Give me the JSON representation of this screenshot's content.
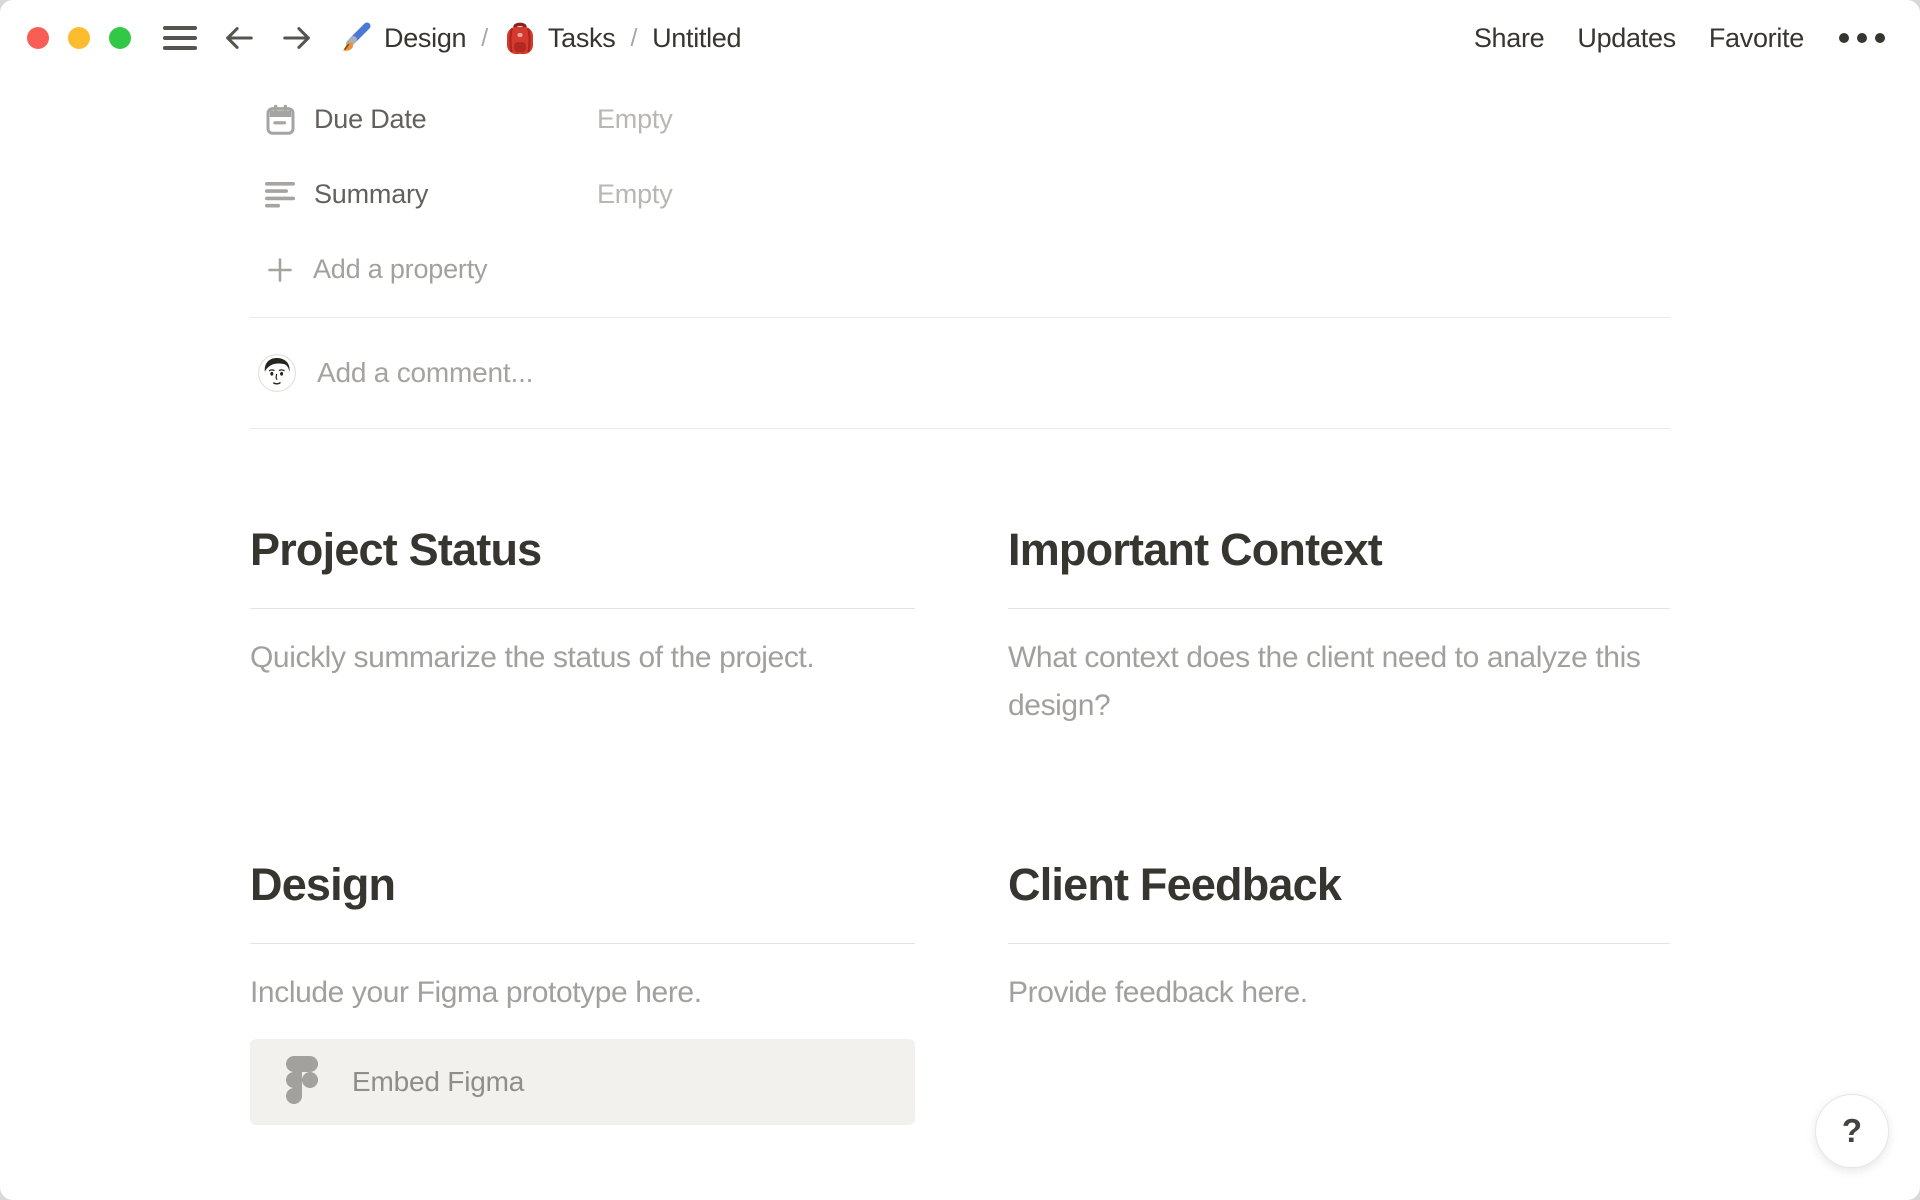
{
  "window": {
    "traffic_lights": [
      "close",
      "minimize",
      "zoom"
    ]
  },
  "topbar": {
    "separator": "/",
    "breadcrumb": {
      "item1": {
        "icon": "paintbrush",
        "label": "Design"
      },
      "item2": {
        "icon": "backpack",
        "label": "Tasks"
      },
      "item3": {
        "label": "Untitled"
      }
    },
    "actions": {
      "share": "Share",
      "updates": "Updates",
      "favorite": "Favorite"
    }
  },
  "properties": {
    "rows": [
      {
        "icon": "calendar-icon",
        "name": "Due Date",
        "value": "Empty"
      },
      {
        "icon": "text-align-icon",
        "name": "Summary",
        "value": "Empty"
      }
    ],
    "add_property_label": "Add a property"
  },
  "comment": {
    "placeholder": "Add a comment..."
  },
  "sections": [
    {
      "title": "Project Status",
      "body": "Quickly summarize the status of the project."
    },
    {
      "title": "Important Context",
      "body": "What context does the client need to analyze this design?"
    },
    {
      "title": "Design",
      "body": "Include your Figma prototype here.",
      "embed_label": "Embed Figma",
      "embed_icon": "figma-icon"
    },
    {
      "title": "Client Feedback",
      "body": "Provide feedback here."
    }
  ],
  "help": {
    "label": "?"
  },
  "colors": {
    "text": "#37352f",
    "muted_text": "#a2a09d",
    "empty_value": "#b8b7b4",
    "divider": "#eceae7",
    "embed_background": "#f2f1ee",
    "traffic_red": "#f85e56",
    "traffic_yellow": "#fbbc2d",
    "traffic_green": "#33c748"
  }
}
